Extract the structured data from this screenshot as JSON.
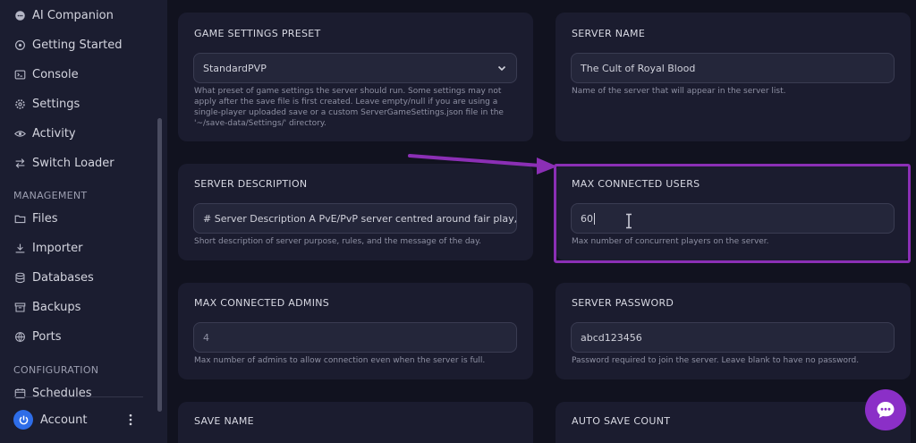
{
  "sidebar": {
    "items": [
      {
        "label": "AI Companion",
        "icon": "chat-bubble-icon"
      },
      {
        "label": "Getting Started",
        "icon": "rocket-icon"
      },
      {
        "label": "Console",
        "icon": "terminal-icon"
      },
      {
        "label": "Settings",
        "icon": "gear-icon"
      },
      {
        "label": "Activity",
        "icon": "eye-icon"
      },
      {
        "label": "Switch Loader",
        "icon": "switch-arrows-icon"
      }
    ],
    "management_label": "MANAGEMENT",
    "management_items": [
      {
        "label": "Files",
        "icon": "folder-icon"
      },
      {
        "label": "Importer",
        "icon": "download-icon"
      },
      {
        "label": "Databases",
        "icon": "database-icon"
      },
      {
        "label": "Backups",
        "icon": "archive-icon"
      },
      {
        "label": "Ports",
        "icon": "network-icon"
      }
    ],
    "configuration_label": "CONFIGURATION",
    "configuration_items": [
      {
        "label": "Schedules",
        "icon": "calendar-icon"
      }
    ],
    "account_label": "Account"
  },
  "settings": {
    "game_settings_preset": {
      "title": "GAME SETTINGS PRESET",
      "value": "StandardPVP",
      "help": "What preset of game settings the server should run. Some settings may not apply after the save file is first created. Leave empty/null if you are using a single-player uploaded save or a custom ServerGameSettings.json file in the '~/save-data/Settings/' directory."
    },
    "server_name": {
      "title": "SERVER NAME",
      "value": "The Cult of Royal Blood",
      "help": "Name of the server that will appear in the server list."
    },
    "server_description": {
      "title": "SERVER DESCRIPTION",
      "value": "# Server Description A PvE/PvP server centred around fair play, quic",
      "help": "Short description of server purpose, rules, and the message of the day."
    },
    "max_connected_users": {
      "title": "MAX CONNECTED USERS",
      "value": "60",
      "help": "Max number of concurrent players on the server."
    },
    "max_connected_admins": {
      "title": "MAX CONNECTED ADMINS",
      "value": "4",
      "help": "Max number of admins to allow connection even when the server is full."
    },
    "server_password": {
      "title": "SERVER PASSWORD",
      "value": "abcd123456",
      "help": "Password required to join the server. Leave blank to have no password."
    },
    "save_name": {
      "title": "SAVE NAME"
    },
    "auto_save_count": {
      "title": "AUTO SAVE COUNT"
    }
  },
  "colors": {
    "accent_purple": "#8b2fb5",
    "avatar_blue": "#2e6de8"
  }
}
